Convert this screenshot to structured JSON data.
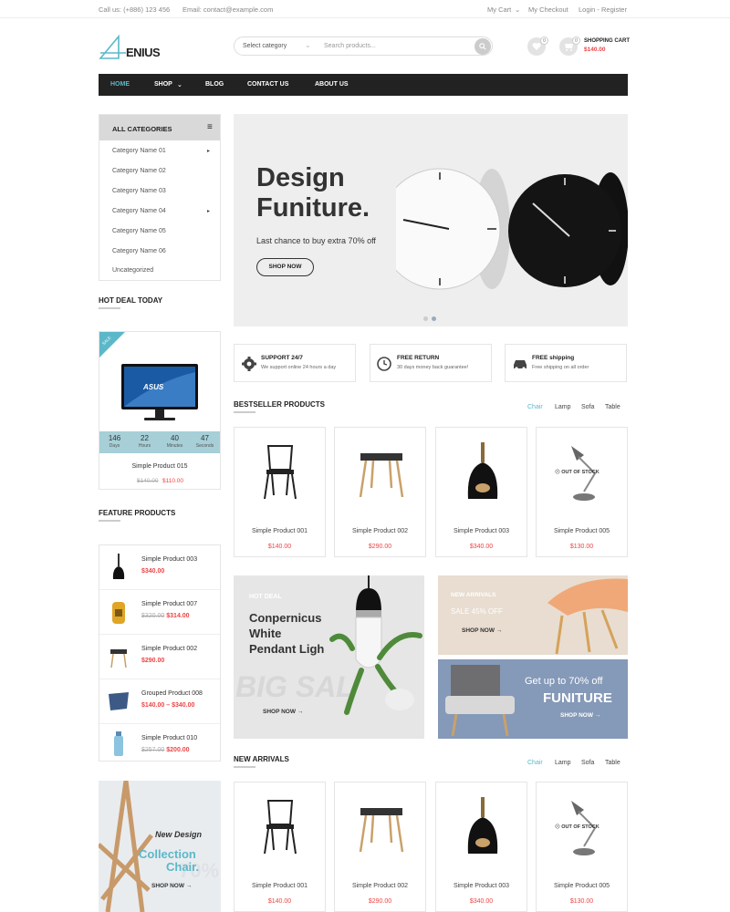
{
  "topbar": {
    "phone": "Call us: (+886) 123 456",
    "email": "Email: contact@example.com",
    "my_cart": "My Cart",
    "my_checkout": "My Checkout",
    "login": "Login - Register"
  },
  "header": {
    "logo_text": "ENIUS",
    "search_category": "Select category",
    "search_placeholder": "Search products...",
    "cart_label": "SHOPPING CART",
    "cart_total": "$140.00",
    "wishlist_count": "0",
    "cart_count": "0"
  },
  "nav": [
    "HOME",
    "SHOP",
    "BLOG",
    "CONTACT US",
    "ABOUT US"
  ],
  "categories": {
    "title": "ALL CATEGORIES",
    "items": [
      "Category Name 01",
      "Category Name 02",
      "Category Name 03",
      "Category Name 04",
      "Category Name 05",
      "Category Name 06",
      "Uncategorized"
    ]
  },
  "hot_deal": {
    "title": "HOT DEAL TODAY",
    "sale_tag": "SALE",
    "timer": [
      {
        "v": "146",
        "u": "Days"
      },
      {
        "v": "22",
        "u": "Hours"
      },
      {
        "v": "40",
        "u": "Minutes"
      },
      {
        "v": "47",
        "u": "Seconds"
      }
    ],
    "product": "Simple Product 015",
    "old_price": "$140.00",
    "price": "$110.00",
    "screen_text": "ASUS"
  },
  "feature": {
    "title": "FEATURE PRODUCTS",
    "items": [
      {
        "name": "Simple Product 003",
        "old": "",
        "price": "$340.00"
      },
      {
        "name": "Simple Product 007",
        "old": "$320.00",
        "price": "$314.00"
      },
      {
        "name": "Simple Product 002",
        "old": "",
        "price": "$290.00"
      },
      {
        "name": "Grouped Product 008",
        "old": "",
        "price": "$140.00 – $340.00"
      },
      {
        "name": "Simple Product 010",
        "old": "$257.00",
        "price": "$200.00"
      }
    ]
  },
  "promo_left": {
    "line1": "New Design",
    "line2": "Collection",
    "line3": "Chair.",
    "cta": "SHOP NOW →",
    "bg_text": "70%"
  },
  "hero": {
    "title1": "Design",
    "title2": "Funiture.",
    "subtitle": "Last chance to buy extra 70% off",
    "cta": "SHOP NOW"
  },
  "features": [
    {
      "title": "SUPPORT 24/7",
      "sub": "We support online 24 hours a day",
      "icon": "gear-icon"
    },
    {
      "title": "FREE RETURN",
      "sub": "30 days money back guarantee!",
      "icon": "clock-icon"
    },
    {
      "title": "FREE shipping",
      "sub": "Free shipping on all order",
      "icon": "car-icon"
    }
  ],
  "bestseller": {
    "title": "BESTSELLER PRODUCTS",
    "tabs": [
      "Chair",
      "Lamp",
      "Sofa",
      "Table"
    ],
    "products": [
      {
        "name": "Simple Product 001",
        "price": "$140.00"
      },
      {
        "name": "Simple Product 002",
        "price": "$290.00"
      },
      {
        "name": "Simple Product 003",
        "price": "$340.00"
      },
      {
        "name": "Simple Product 005",
        "price": "$130.00"
      }
    ],
    "out_of_stock": "OUT OF STOCK"
  },
  "banner_hot": {
    "tag": "HOT DEAL",
    "line1": "Conpernicus",
    "line2": "White",
    "line3": "Pendant Ligh",
    "cta": "SHOP NOW →",
    "bg_text": "BIG SAL"
  },
  "banner_new": {
    "tag": "NEW ARRIVALS",
    "sale": "SALE 45% OFF",
    "cta": "SHOP NOW →"
  },
  "banner_70": {
    "line1": "Get up to 70% off",
    "line2": "FUNITURE",
    "cta": "SHOP NOW →"
  },
  "new_arrivals": {
    "title": "NEW ARRIVALS",
    "tabs": [
      "Chair",
      "Lamp",
      "Sofa",
      "Table"
    ],
    "products": [
      {
        "name": "Simple Product 001",
        "price": "$140.00"
      },
      {
        "name": "Simple Product 002",
        "price": "$290.00"
      },
      {
        "name": "Simple Product 003",
        "price": "$340.00"
      },
      {
        "name": "Simple Product 005",
        "price": "$130.00"
      }
    ],
    "out_of_stock": "OUT OF STOCK"
  },
  "colors": {
    "accent": "#5bb8c9",
    "price": "#e44444",
    "nav_bg": "#222222",
    "timer_bg": "#a6cfd7",
    "banner_blue": "#8599b8",
    "banner_beige": "#e8ddd0"
  }
}
